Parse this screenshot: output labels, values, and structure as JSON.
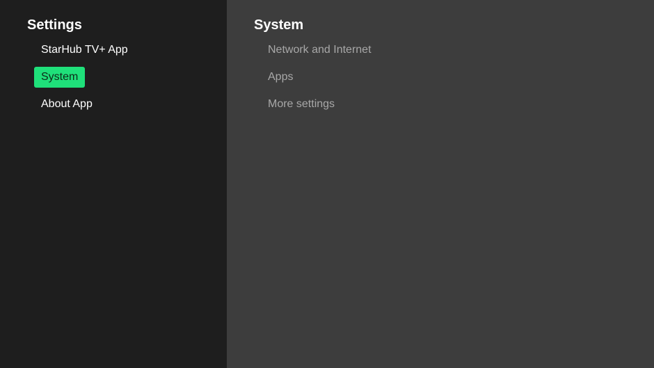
{
  "sidebar": {
    "title": "Settings",
    "items": [
      {
        "label": "StarHub TV+ App",
        "selected": false
      },
      {
        "label": "System",
        "selected": true
      },
      {
        "label": "About App",
        "selected": false
      }
    ]
  },
  "detail": {
    "title": "System",
    "items": [
      {
        "label": "Network and Internet"
      },
      {
        "label": "Apps"
      },
      {
        "label": "More settings"
      }
    ]
  },
  "colors": {
    "sidebar_bg": "#1e1e1e",
    "detail_bg": "#3d3d3d",
    "accent": "#1fe07a",
    "sub_text": "#a8a8a8"
  }
}
